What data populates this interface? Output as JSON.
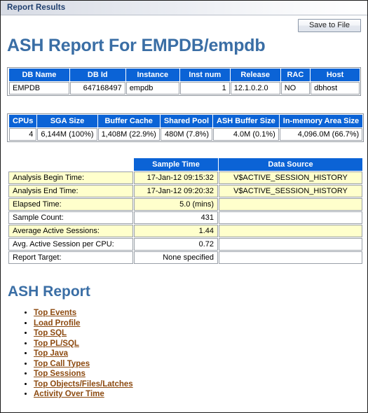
{
  "window": {
    "title": "Report Results"
  },
  "toolbar": {
    "save_label": "Save to File"
  },
  "headings": {
    "main": "ASH Report For EMPDB/empdb",
    "section": "ASH Report"
  },
  "db_table": {
    "headers": [
      "DB Name",
      "DB Id",
      "Instance",
      "Inst num",
      "Release",
      "RAC",
      "Host"
    ],
    "rows": [
      {
        "db_name": "EMPDB",
        "db_id": "647168497",
        "instance": "empdb",
        "inst_num": "1",
        "release": "12.1.0.2.0",
        "rac": "NO",
        "host": "dbhost"
      }
    ]
  },
  "memory_table": {
    "headers": [
      "CPUs",
      "SGA Size",
      "Buffer Cache",
      "Shared Pool",
      "ASH Buffer Size",
      "In-memory Area Size"
    ],
    "rows": [
      {
        "cpus": "4",
        "sga_size": "6,144M (100%)",
        "buffer_cache": "1,408M (22.9%)",
        "shared_pool": "480M (7.8%)",
        "ash_buffer_size": "4.0M (0.1%)",
        "in_memory_area_size": "4,096.0M (66.7%)"
      }
    ]
  },
  "sample_table": {
    "headers": [
      "",
      "Sample Time",
      "Data Source"
    ],
    "rows": [
      {
        "label": "Analysis Begin Time:",
        "value": "17-Jan-12 09:15:32",
        "source": "V$ACTIVE_SESSION_HISTORY",
        "shaded": true
      },
      {
        "label": "Analysis End Time:",
        "value": "17-Jan-12 09:20:32",
        "source": "V$ACTIVE_SESSION_HISTORY",
        "shaded": true
      },
      {
        "label": "Elapsed Time:",
        "value": "5.0 (mins)",
        "source": "",
        "shaded": true
      },
      {
        "label": "Sample Count:",
        "value": "431",
        "source": "",
        "shaded": false
      },
      {
        "label": "Average Active Sessions:",
        "value": "1.44",
        "source": "",
        "shaded": true
      },
      {
        "label": "Avg. Active Session per CPU:",
        "value": "0.72",
        "source": "",
        "shaded": false
      },
      {
        "label": "Report Target:",
        "value": "None specified",
        "source": "",
        "shaded": false
      }
    ]
  },
  "links": [
    {
      "label": "Top Events"
    },
    {
      "label": "Load Profile"
    },
    {
      "label": "Top SQL"
    },
    {
      "label": "Top PL/SQL"
    },
    {
      "label": "Top Java"
    },
    {
      "label": "Top Call Types"
    },
    {
      "label": "Top Sessions"
    },
    {
      "label": "Top Objects/Files/Latches"
    },
    {
      "label": "Activity Over Time"
    }
  ],
  "colors": {
    "table_header_blue": "#0b63d6",
    "heading_blue": "#3a6ea5",
    "title_blue": "#1f3f6e",
    "row_highlight": "#ffffcc",
    "link_brown": "#8c4a10"
  }
}
